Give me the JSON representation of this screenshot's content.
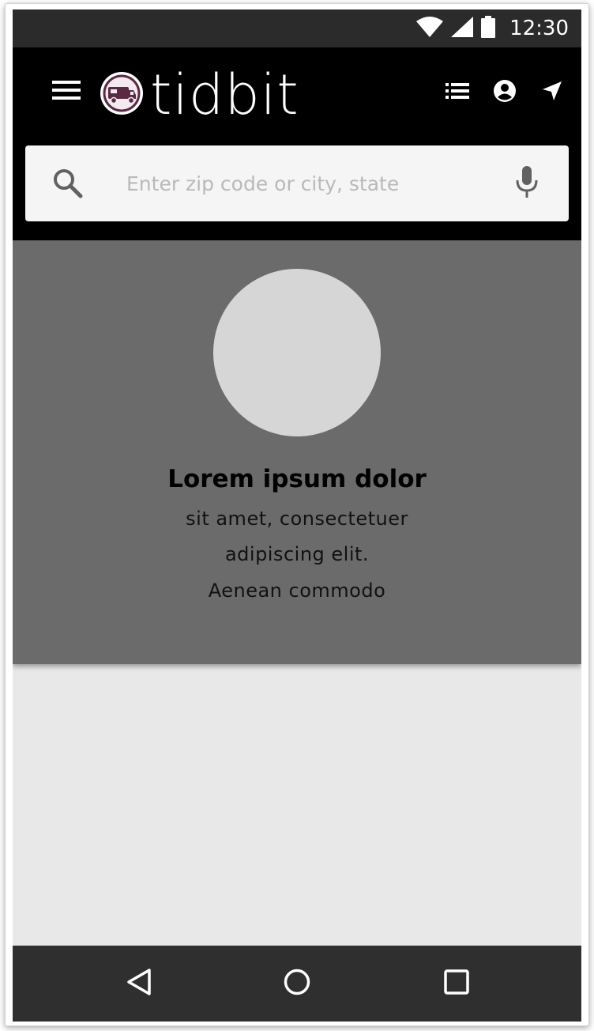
{
  "status_bar": {
    "time": "12:30",
    "icons": [
      "wifi-icon",
      "cellular-signal-icon",
      "battery-icon"
    ]
  },
  "app_bar": {
    "logo_text": "tidbit",
    "icons": [
      "menu-icon",
      "food-truck-logo-icon",
      "list-icon",
      "account-icon",
      "navigation-icon"
    ]
  },
  "search": {
    "placeholder": "Enter zip code or city, state",
    "value": "",
    "icons": [
      "search-icon",
      "mic-icon"
    ]
  },
  "hero": {
    "title": "Lorem ipsum dolor",
    "lines": [
      "sit amet, consectetuer",
      "adipiscing elit.",
      "Aenean commodo"
    ]
  },
  "nav_bar": {
    "icons": [
      "back-icon",
      "home-icon",
      "recents-icon"
    ]
  },
  "colors": {
    "status_bar": "#2b2b2b",
    "app_bar": "#000000",
    "search_bg": "#f5f5f5",
    "hero_bg": "#6b6b6b",
    "avatar": "#d6d6d6",
    "content_bg": "#e8e8e8",
    "nav_bar": "#2f2f2f",
    "logo_accent": "#5a2a44"
  }
}
